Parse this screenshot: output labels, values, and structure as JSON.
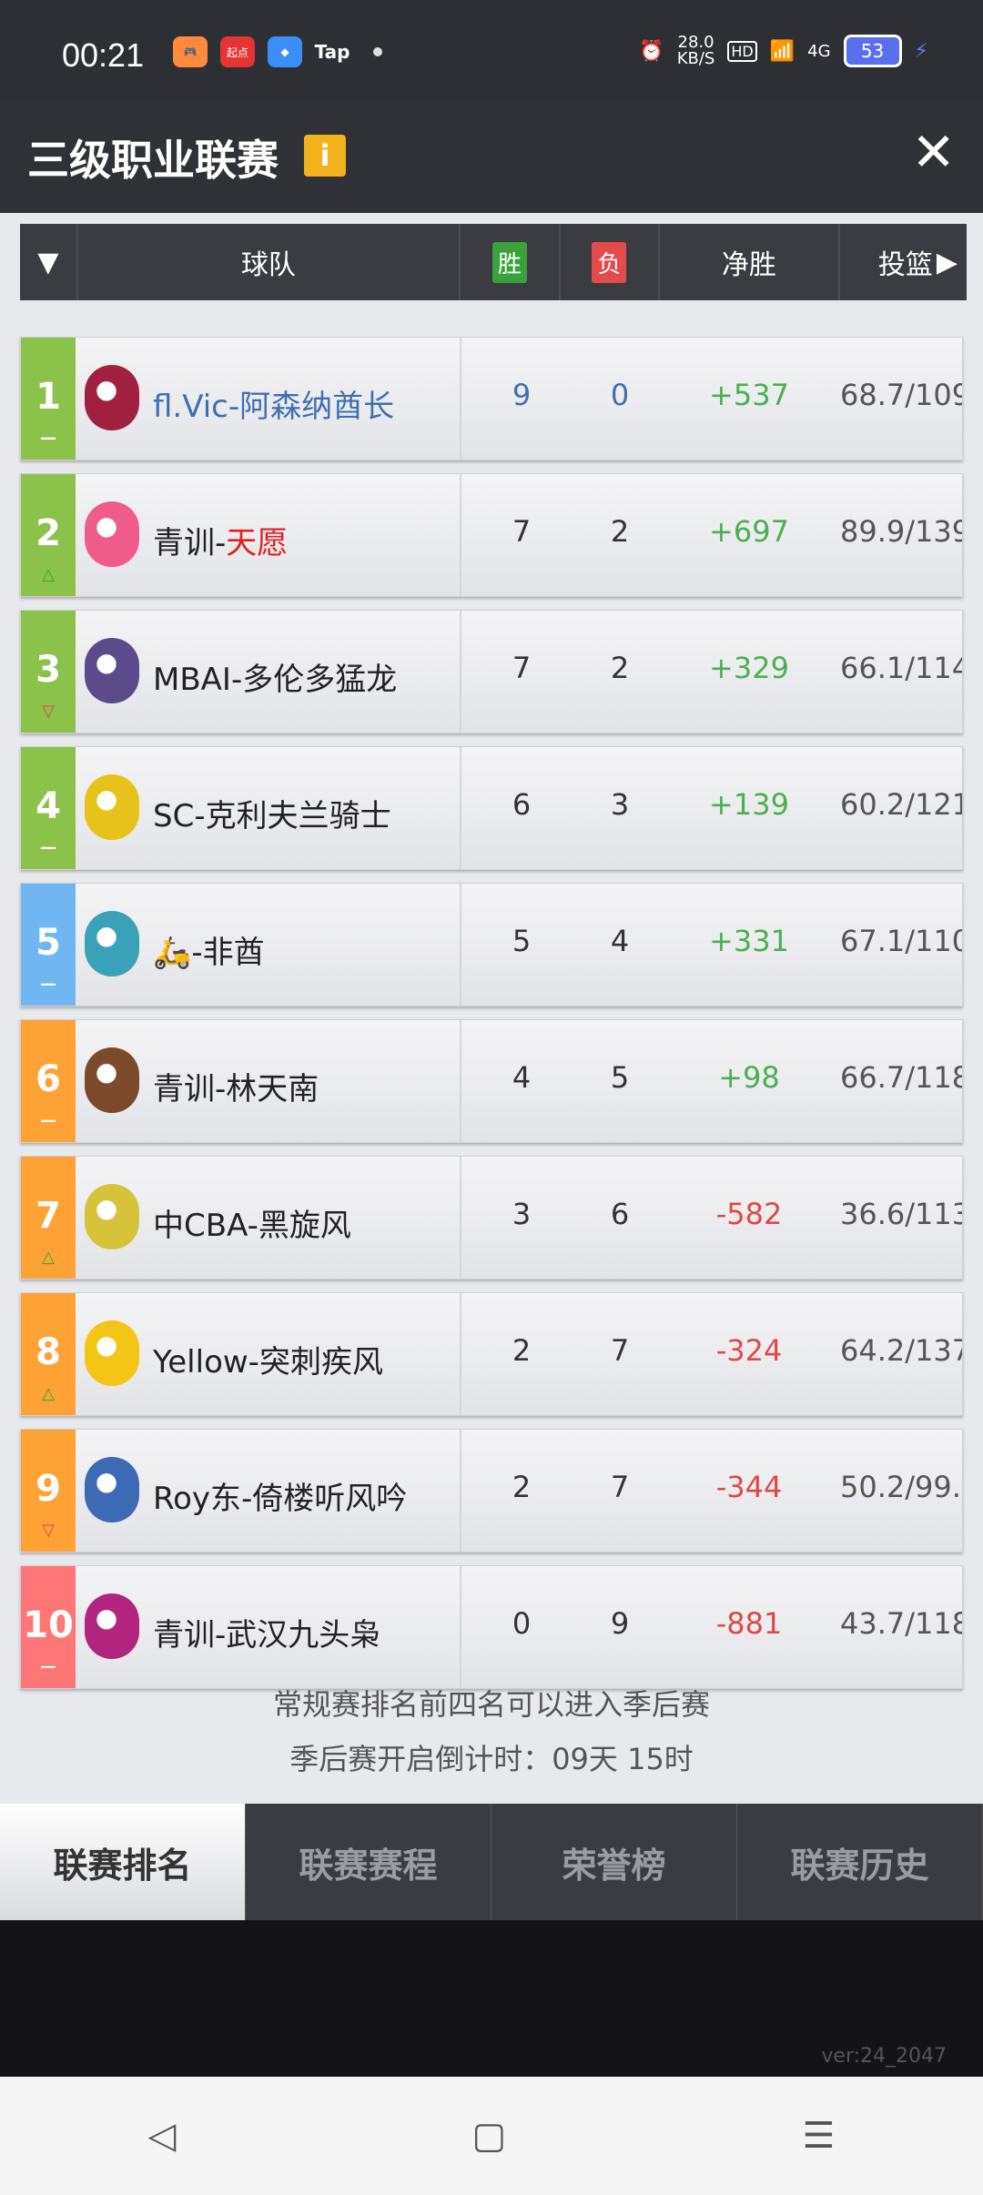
{
  "status": {
    "time": "00:21",
    "apps": [
      "",
      "起点",
      "",
      "Tap"
    ],
    "net_speed": "28.0",
    "net_unit": "KB/S",
    "hd": "HD",
    "signal": "4G",
    "battery": "53"
  },
  "title": {
    "text": "三级职业联赛",
    "info_icon": "i",
    "close_icon": "✕"
  },
  "header": {
    "team": "球队",
    "win": "胜",
    "loss": "负",
    "net": "净胜",
    "shoot": "投篮"
  },
  "teams": [
    {
      "rank": "1",
      "trend": "—",
      "name": "fl.Vic-阿森纳酋长",
      "wins": "9",
      "losses": "0",
      "net": "+537",
      "shoot": "68.7/109",
      "rank_color": "#8bc34a",
      "logo_color": "#a1203f"
    },
    {
      "rank": "2",
      "trend": "△",
      "name_prefix": "青训-",
      "name_suffix": "天愿",
      "wins": "7",
      "losses": "2",
      "net": "+697",
      "shoot": "89.9/139",
      "rank_color": "#8bc34a",
      "logo_color": "#ef5b8b"
    },
    {
      "rank": "3",
      "trend": "▽",
      "name": "MBAI-多伦多猛龙",
      "wins": "7",
      "losses": "2",
      "net": "+329",
      "shoot": "66.1/114",
      "rank_color": "#8bc34a",
      "logo_color": "#5b4b8a"
    },
    {
      "rank": "4",
      "trend": "—",
      "name": "SC-克利夫兰骑士",
      "wins": "6",
      "losses": "3",
      "net": "+139",
      "shoot": "60.2/121",
      "rank_color": "#8bc34a",
      "logo_color": "#e7c21a"
    },
    {
      "rank": "5",
      "trend": "—",
      "name": "🛵-非酋",
      "wins": "5",
      "losses": "4",
      "net": "+331",
      "shoot": "67.1/110",
      "rank_color": "#6fb6f2",
      "logo_color": "#3aa2b8"
    },
    {
      "rank": "6",
      "trend": "—",
      "name": "青训-林天南",
      "wins": "4",
      "losses": "5",
      "net": "+98",
      "shoot": "66.7/118",
      "rank_color": "#ffa235",
      "logo_color": "#7a4a2a"
    },
    {
      "rank": "7",
      "trend": "△",
      "name": "中CBA-黑旋风",
      "wins": "3",
      "losses": "6",
      "net": "-582",
      "shoot": "36.6/113",
      "rank_color": "#ffa235",
      "logo_color": "#d6c33a"
    },
    {
      "rank": "8",
      "trend": "△",
      "name": "Yellow-突刺疾风",
      "wins": "2",
      "losses": "7",
      "net": "-324",
      "shoot": "64.2/137",
      "rank_color": "#ffa235",
      "logo_color": "#f3c514"
    },
    {
      "rank": "9",
      "trend": "▽",
      "name": "Roy东-倚楼听风吟",
      "wins": "2",
      "losses": "7",
      "net": "-344",
      "shoot": "50.2/99.",
      "rank_color": "#ffa235",
      "logo_color": "#3d6ab5"
    },
    {
      "rank": "10",
      "trend": "—",
      "name": "青训-武汉九头枭",
      "wins": "0",
      "losses": "9",
      "net": "-881",
      "shoot": "43.7/118",
      "rank_color": "#ff7676",
      "logo_color": "#b3247c"
    }
  ],
  "notes": {
    "line1": "常规赛排名前四名可以进入季后赛",
    "line2": "季后赛开启倒计时：09天 15时"
  },
  "tabs": [
    "联赛排名",
    "联赛赛程",
    "荣誉榜",
    "联赛历史"
  ],
  "version": "ver:24_2047",
  "nav": {
    "back": "◁",
    "home": "▢",
    "menu": "☰"
  },
  "colors": {
    "positive": "#4caf50",
    "negative": "#e04848",
    "highlight_blue": "#3f6fb0",
    "highlight_red": "#e02020"
  }
}
